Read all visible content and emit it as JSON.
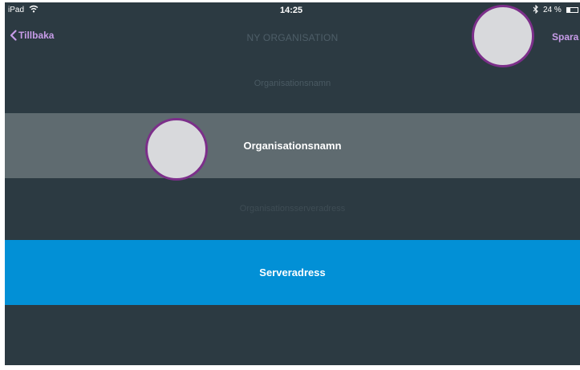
{
  "status_bar": {
    "device": "iPad",
    "time": "14:25",
    "battery": "24 %",
    "icons": [
      "wifi-icon",
      "bluetooth-icon",
      "battery-icon"
    ]
  },
  "nav": {
    "back_label": "Tillbaka",
    "title": "NY ORGANISATION",
    "save_label": "Spara"
  },
  "form": {
    "org_name_label": "Organisationsnamn",
    "org_name_placeholder": "Organisationsnamn",
    "server_label": "Organisationsserveradress",
    "server_placeholder": "Serveradress"
  },
  "colors": {
    "background": "#2c3a42",
    "accent": "#c79ce8",
    "active_field": "#0290d6",
    "input_field": "#5f6b70",
    "touch_ring": "#7c2f8a"
  }
}
